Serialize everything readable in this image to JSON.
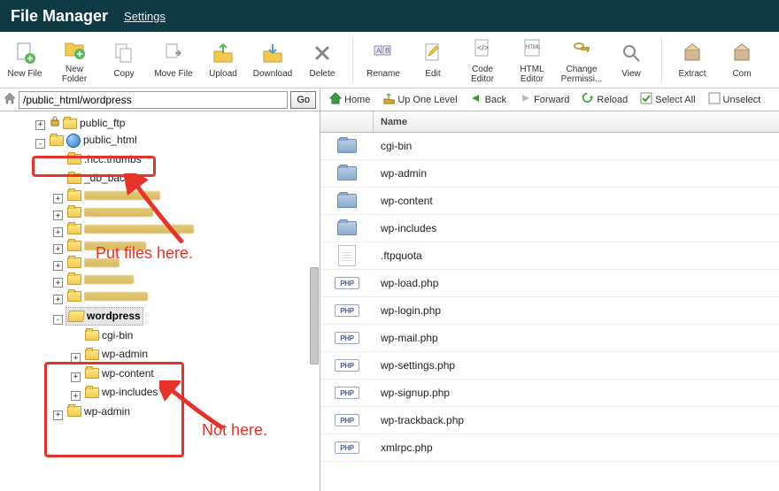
{
  "header": {
    "title": "File Manager",
    "settings": "Settings"
  },
  "toolbar": [
    {
      "id": "new-file",
      "label": "New File"
    },
    {
      "id": "new-folder",
      "label": "New\nFolder"
    },
    {
      "id": "copy",
      "label": "Copy"
    },
    {
      "id": "move",
      "label": "Move File"
    },
    {
      "id": "upload",
      "label": "Upload"
    },
    {
      "id": "download",
      "label": "Download"
    },
    {
      "id": "delete",
      "label": "Delete"
    },
    {
      "sep": true
    },
    {
      "id": "rename",
      "label": "Rename"
    },
    {
      "id": "edit",
      "label": "Edit"
    },
    {
      "id": "code-editor",
      "label": "Code\nEditor"
    },
    {
      "id": "html-editor",
      "label": "HTML\nEditor"
    },
    {
      "id": "change-perm",
      "label": "Change\nPermissi..."
    },
    {
      "id": "view",
      "label": "View"
    },
    {
      "sep": true
    },
    {
      "id": "extract",
      "label": "Extract"
    },
    {
      "id": "compress",
      "label": "Com"
    }
  ],
  "pathbar": {
    "value": "/public_html/wordpress",
    "go": "Go"
  },
  "tree": {
    "root": [
      {
        "exp": "+",
        "depth": 1,
        "label": "public_ftp",
        "icons": [
          "lock",
          "fold"
        ]
      },
      {
        "exp": "-",
        "depth": 1,
        "label": "public_html",
        "icons": [
          "fold",
          "globe"
        ],
        "hl": "box1"
      },
      {
        "exp": "",
        "depth": 2,
        "label": ".hcc.thumbs",
        "icons": [
          "fold"
        ]
      },
      {
        "exp": "",
        "depth": 2,
        "label": "_db_backups",
        "icons": [
          "fold"
        ]
      },
      {
        "exp": "+",
        "depth": 2,
        "blur": 86,
        "icons": [
          "fold"
        ]
      },
      {
        "exp": "+",
        "depth": 2,
        "blur": 78,
        "icons": [
          "fold"
        ]
      },
      {
        "exp": "+",
        "depth": 2,
        "blur": 124,
        "icons": [
          "fold"
        ]
      },
      {
        "exp": "+",
        "depth": 2,
        "blur": 70,
        "icons": [
          "fold"
        ]
      },
      {
        "exp": "+",
        "depth": 2,
        "blur": 40,
        "icons": [
          "fold"
        ]
      },
      {
        "exp": "+",
        "depth": 2,
        "blur": 56,
        "icons": [
          "fold"
        ]
      },
      {
        "exp": "+",
        "depth": 2,
        "blur": 72,
        "icons": [
          "fold"
        ]
      },
      {
        "exp": "-",
        "depth": 2,
        "label": "wordpress",
        "icons": [
          "foldopen"
        ],
        "bold": true,
        "sel": true
      },
      {
        "exp": "",
        "depth": 3,
        "label": "cgi-bin",
        "icons": [
          "fold"
        ]
      },
      {
        "exp": "+",
        "depth": 3,
        "label": "wp-admin",
        "icons": [
          "fold"
        ]
      },
      {
        "exp": "+",
        "depth": 3,
        "label": "wp-content",
        "icons": [
          "fold"
        ]
      },
      {
        "exp": "+",
        "depth": 3,
        "label": "wp-includes",
        "icons": [
          "fold"
        ]
      },
      {
        "exp": "+",
        "depth": 2,
        "label": "wp-admin",
        "icons": [
          "fold"
        ]
      }
    ]
  },
  "rtools": [
    {
      "id": "home",
      "label": "Home",
      "color": "#3a9e3a"
    },
    {
      "id": "up",
      "label": "Up One Level",
      "color": "#d8a52f"
    },
    {
      "id": "back",
      "label": "Back",
      "color": "#3a9e3a"
    },
    {
      "id": "forward",
      "label": "Forward",
      "color": "#bdbdbd"
    },
    {
      "id": "reload",
      "label": "Reload",
      "color": "#3a9e3a"
    },
    {
      "id": "select-all",
      "label": "Select All",
      "color": "#3a9e3a",
      "sq": true
    },
    {
      "id": "unselect",
      "label": "Unselect",
      "color": "#8a8a8a",
      "sq": true
    }
  ],
  "listhead": {
    "name": "Name"
  },
  "files": [
    {
      "icon": "folder",
      "name": "cgi-bin"
    },
    {
      "icon": "folder",
      "name": "wp-admin"
    },
    {
      "icon": "folder",
      "name": "wp-content"
    },
    {
      "icon": "folder",
      "name": "wp-includes"
    },
    {
      "icon": "doc",
      "name": ".ftpquota"
    },
    {
      "icon": "php",
      "name": "wp-load.php"
    },
    {
      "icon": "php",
      "name": "wp-login.php"
    },
    {
      "icon": "php",
      "name": "wp-mail.php"
    },
    {
      "icon": "php",
      "name": "wp-settings.php"
    },
    {
      "icon": "php",
      "name": "wp-signup.php"
    },
    {
      "icon": "php",
      "name": "wp-trackback.php"
    },
    {
      "icon": "php",
      "name": "xmlrpc.php"
    }
  ],
  "annotations": {
    "put_here": "Put files here.",
    "not_here": "Not here."
  }
}
